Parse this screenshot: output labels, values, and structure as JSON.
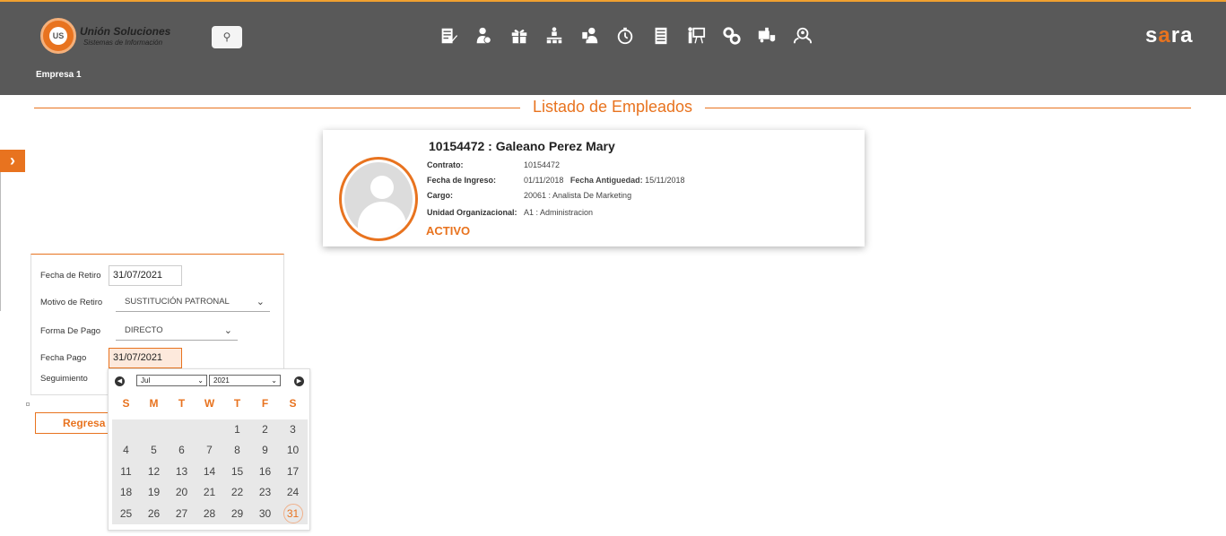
{
  "header": {
    "logo_text": "Unión Soluciones",
    "logo_subtext": "Sistemas de Información",
    "logo_badge": "US",
    "company": "Empresa 1",
    "brand": "sara",
    "nav_icons": [
      "form-edit-icon",
      "user-money-icon",
      "gift-icon",
      "org-chart-icon",
      "employee-id-icon",
      "timer-icon",
      "document-list-icon",
      "presentation-icon",
      "gears-icon",
      "truck-shield-icon",
      "user-search-icon"
    ]
  },
  "page": {
    "title": "Listado de Empleados"
  },
  "employee": {
    "name": "10154472 : Galeano Perez Mary",
    "contrato_label": "Contrato:",
    "contrato_value": "10154472",
    "ingreso_label": "Fecha de Ingreso:",
    "ingreso_value": "01/11/2018",
    "antiguedad_label": "Fecha Antiguedad:",
    "antiguedad_value": "15/11/2018",
    "cargo_label": "Cargo:",
    "cargo_value": "20061 : Analista De Marketing",
    "unidad_label": "Unidad Organizacional:",
    "unidad_value": "A1 : Administracion",
    "status": "ACTIVO"
  },
  "form": {
    "fecha_retiro_label": "Fecha de Retiro",
    "fecha_retiro_value": "31/07/2021",
    "motivo_label": "Motivo de Retiro",
    "motivo_value": "SUSTITUCIÓN PATRONAL",
    "forma_pago_label": "Forma De Pago",
    "forma_pago_value": "DIRECTO",
    "fecha_pago_label": "Fecha Pago",
    "fecha_pago_value": "31/07/2021",
    "seguimiento_label": "Seguimiento",
    "regresar_label": "Regresa"
  },
  "calendar": {
    "month": "Jul",
    "year": "2021",
    "weekdays": [
      "S",
      "M",
      "T",
      "W",
      "T",
      "F",
      "S"
    ],
    "cells": [
      "",
      "",
      "",
      "",
      "1",
      "2",
      "3",
      "4",
      "5",
      "6",
      "7",
      "8",
      "9",
      "10",
      "11",
      "12",
      "13",
      "14",
      "15",
      "16",
      "17",
      "18",
      "19",
      "20",
      "21",
      "22",
      "23",
      "24",
      "25",
      "26",
      "27",
      "28",
      "29",
      "30",
      "31"
    ],
    "selected_day": "31"
  }
}
